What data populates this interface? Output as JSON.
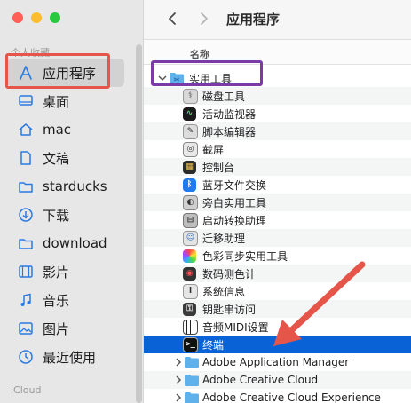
{
  "window": {
    "title": "应用程序"
  },
  "sidebar": {
    "section_favorites": "个人收藏",
    "section_icloud": "iCloud",
    "items": [
      {
        "label": "应用程序",
        "icon": "apps-icon"
      },
      {
        "label": "桌面",
        "icon": "desktop-icon"
      },
      {
        "label": "mac",
        "icon": "home-icon"
      },
      {
        "label": "文稿",
        "icon": "document-icon"
      },
      {
        "label": "starducks",
        "icon": "folder-icon"
      },
      {
        "label": "下载",
        "icon": "download-icon"
      },
      {
        "label": "download",
        "icon": "folder-icon"
      },
      {
        "label": "影片",
        "icon": "film-icon"
      },
      {
        "label": "音乐",
        "icon": "music-icon"
      },
      {
        "label": "图片",
        "icon": "photo-icon"
      },
      {
        "label": "最近使用",
        "icon": "clock-icon"
      }
    ]
  },
  "list": {
    "column_name": "名称",
    "rows": [
      {
        "label": "实用工具",
        "kind": "folder",
        "expanded": true
      },
      {
        "label": "磁盘工具",
        "kind": "app"
      },
      {
        "label": "活动监视器",
        "kind": "app"
      },
      {
        "label": "脚本编辑器",
        "kind": "app"
      },
      {
        "label": "截屏",
        "kind": "app"
      },
      {
        "label": "控制台",
        "kind": "app"
      },
      {
        "label": "蓝牙文件交换",
        "kind": "app"
      },
      {
        "label": "旁白实用工具",
        "kind": "app"
      },
      {
        "label": "启动转换助理",
        "kind": "app"
      },
      {
        "label": "迁移助理",
        "kind": "app"
      },
      {
        "label": "色彩同步实用工具",
        "kind": "app"
      },
      {
        "label": "数码测色计",
        "kind": "app"
      },
      {
        "label": "系统信息",
        "kind": "app"
      },
      {
        "label": "钥匙串访问",
        "kind": "app"
      },
      {
        "label": "音频MIDI设置",
        "kind": "app"
      },
      {
        "label": "终端",
        "kind": "app",
        "selected": true
      },
      {
        "label": "Adobe Application Manager",
        "kind": "folder"
      },
      {
        "label": "Adobe Creative Cloud",
        "kind": "folder"
      },
      {
        "label": "Adobe Creative Cloud Experience",
        "kind": "folder"
      }
    ]
  },
  "colors": {
    "selection": "#0a63d6",
    "annotation_red": "#e5554a",
    "annotation_purple": "#7a3aa8",
    "folder_blue": "#5fb1ec"
  }
}
